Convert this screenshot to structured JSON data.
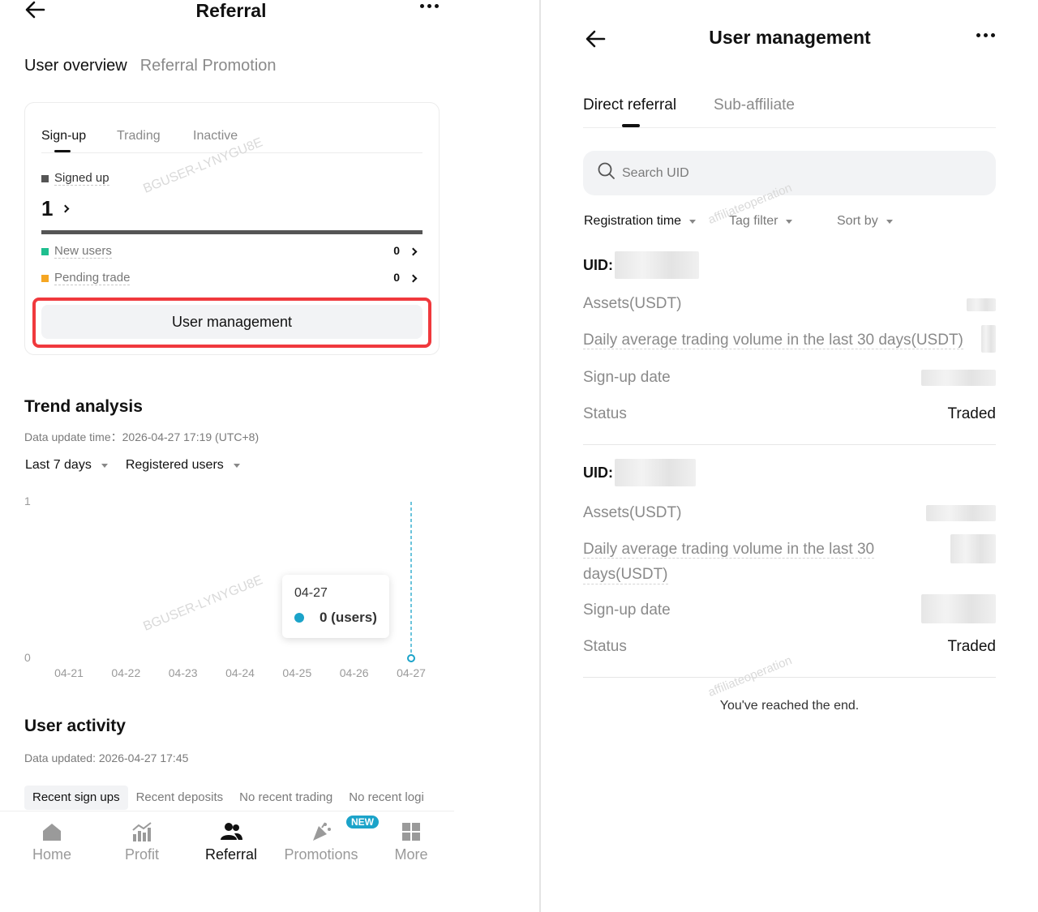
{
  "left": {
    "header": {
      "title": "Referral"
    },
    "top_tabs": [
      "User overview",
      "Referral Promotion"
    ],
    "card": {
      "tabs": [
        "Sign-up",
        "Trading",
        "Inactive"
      ],
      "signed_up_label": "Signed up",
      "signed_up_count": "1",
      "signed_up_share": 1.0,
      "new_users_label": "New users",
      "new_users_count": "0",
      "pending_trade_label": "Pending trade",
      "pending_trade_count": "0",
      "user_management_label": "User management",
      "watermark": "BGUSER-LYNYGU8E"
    },
    "trend": {
      "title": "Trend analysis",
      "update_time": "Data update time：2026-04-27 17:19 (UTC+8)",
      "filter_period": "Last 7 days",
      "filter_metric": "Registered users",
      "watermark": "BGUSER-LYNYGU8E",
      "tooltip_date": "04-27",
      "tooltip_value": "0 (users)"
    },
    "activity": {
      "title": "User activity",
      "updated": "Data updated: 2026-04-27 17:45",
      "tabs": [
        "Recent sign ups",
        "Recent deposits",
        "No recent trading",
        "No recent logi"
      ]
    },
    "nav": {
      "items": [
        "Home",
        "Profit",
        "Referral",
        "Promotions",
        "More"
      ],
      "new_badge": "NEW"
    }
  },
  "chart_data": {
    "type": "line",
    "x": [
      "04-21",
      "04-22",
      "04-23",
      "04-24",
      "04-25",
      "04-26",
      "04-27"
    ],
    "series": [
      {
        "values": [
          0,
          0,
          0,
          0,
          0,
          0,
          0
        ]
      }
    ],
    "y_ticks": [
      "1",
      "0"
    ],
    "ylim": [
      0,
      1
    ],
    "highlight_index": 6,
    "colors": {
      "series": "#1ba3c9"
    }
  },
  "right": {
    "header": {
      "title": "User management"
    },
    "tabs": [
      "Direct referral",
      "Sub-affiliate"
    ],
    "search_placeholder": "Search UID",
    "filters": [
      "Registration time",
      "Tag filter",
      "Sort by"
    ],
    "watermark": "affiliateoperation",
    "records": [
      {
        "uid_label": "UID:",
        "assets_label": "Assets(USDT)",
        "volume_label": "Daily average trading volume in the last 30 days(USDT)",
        "signup_label": "Sign-up date",
        "status_label": "Status",
        "status_value": "Traded"
      },
      {
        "uid_label": "UID:",
        "assets_label": "Assets(USDT)",
        "volume_label_line1": "Daily average trading volume in the last 30",
        "volume_label_line2": "days(USDT)",
        "signup_label": "Sign-up date",
        "status_label": "Status",
        "status_value": "Traded"
      }
    ],
    "end_note": "You've reached the end."
  },
  "colors": {
    "accent_red": "#f0393d",
    "teal": "#1ba3c9",
    "green": "#1fbf8f",
    "orange": "#f5a623",
    "dark": "#555555"
  }
}
